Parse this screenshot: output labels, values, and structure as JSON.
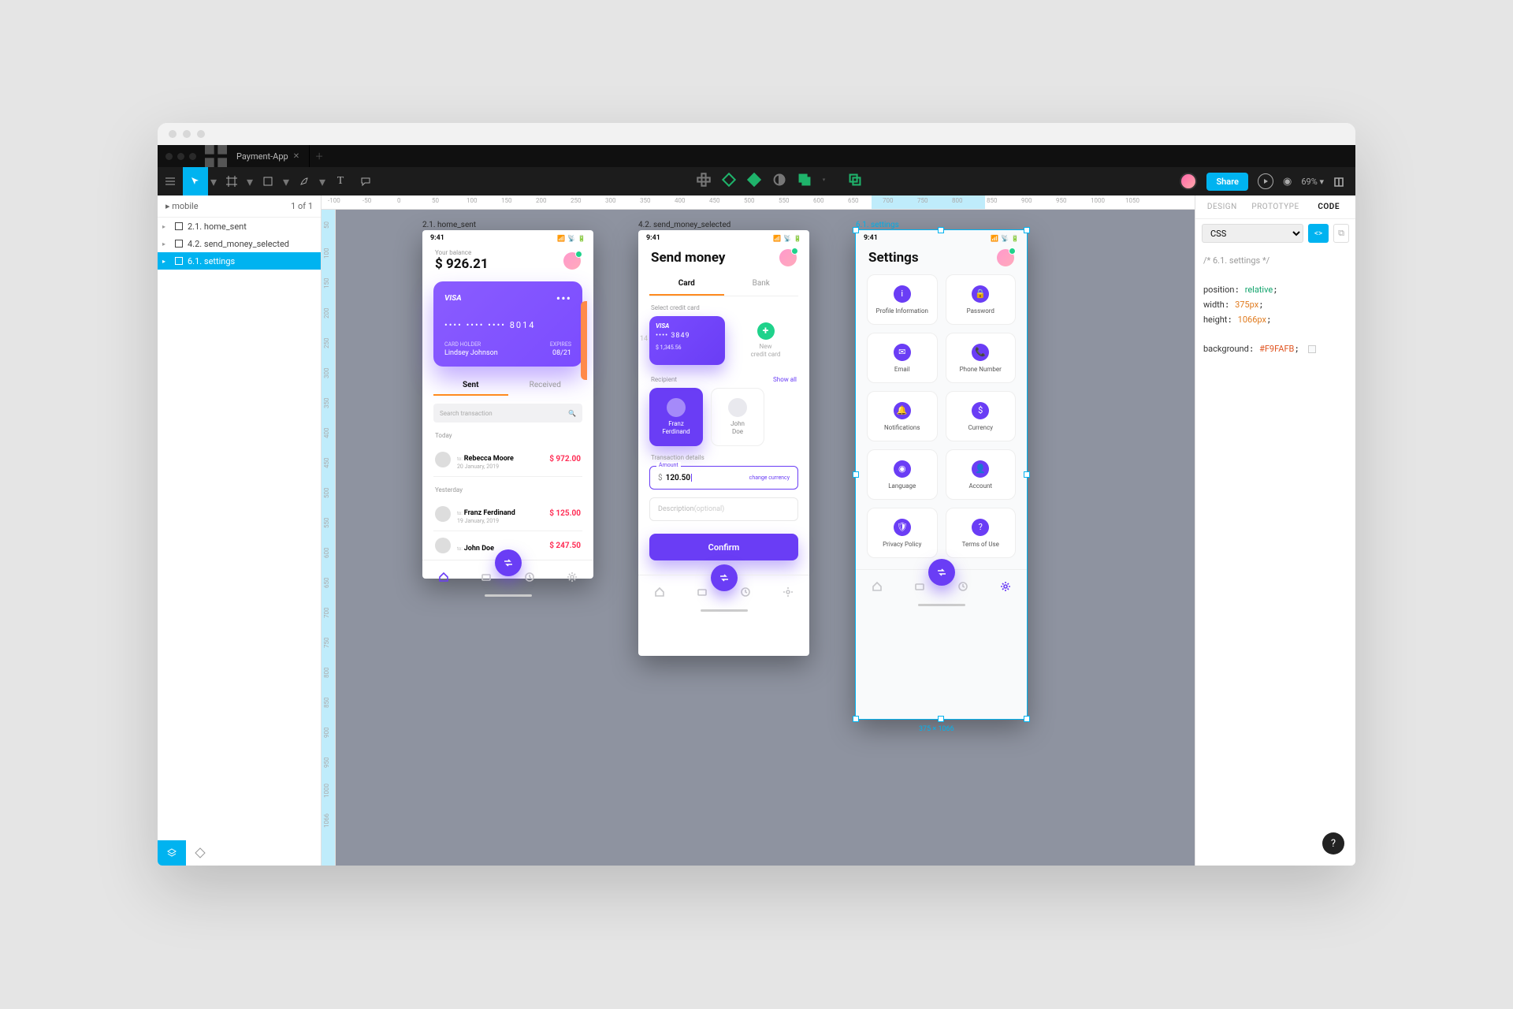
{
  "tab": {
    "name": "Payment-App"
  },
  "toolbar": {
    "share": "Share",
    "zoom": "69%"
  },
  "leftPanel": {
    "page": "mobile",
    "pageCount": "1 of 1",
    "items": [
      {
        "label": "2.1. home_sent"
      },
      {
        "label": "4.2. send_money_selected"
      },
      {
        "label": "6.1. settings"
      }
    ]
  },
  "rulerH": [
    "-100",
    "-50",
    "0",
    "50",
    "100",
    "150",
    "200",
    "250",
    "300",
    "350",
    "400",
    "450",
    "500",
    "550",
    "600",
    "650",
    "700",
    "750",
    "800",
    "850",
    "900",
    "950",
    "1000",
    "1050"
  ],
  "rulerV": [
    "50",
    "100",
    "150",
    "200",
    "250",
    "300",
    "350",
    "400",
    "450",
    "500",
    "550",
    "600",
    "650",
    "700",
    "750",
    "800",
    "850",
    "900",
    "950",
    "1000",
    "1066"
  ],
  "rulerSel": {
    "hStart": "800",
    "hEnd": "975",
    "vEnd": "1066"
  },
  "rightPanel": {
    "tabs": [
      "DESIGN",
      "PROTOTYPE",
      "CODE"
    ],
    "lang": "CSS",
    "code": {
      "comment": "/* 6.1. settings */",
      "lines": [
        {
          "k": "position",
          "v": "relative",
          "cls": "va"
        },
        {
          "k": "width",
          "v": "375px",
          "cls": "nu"
        },
        {
          "k": "height",
          "v": "1066px",
          "cls": "nu"
        }
      ],
      "bgKey": "background",
      "bgVal": "#F9FAFB"
    }
  },
  "artboards": {
    "a1": {
      "label": "2.1. home_sent",
      "time": "9:41",
      "balanceLabel": "Your balance",
      "balance": "$ 926.21",
      "card": {
        "brand": "VISA",
        "mask": "••••  ••••  ••••  8014",
        "holderL": "CARD HOLDER",
        "holder": "Lindsey Johnson",
        "expL": "EXPIRES",
        "exp": "08/21"
      },
      "tabs": [
        "Sent",
        "Received"
      ],
      "searchPh": "Search transaction",
      "groups": [
        {
          "label": "Today",
          "rows": [
            {
              "to": "to:",
              "name": "Rebecca Moore",
              "date": "20 January, 2019",
              "amount": "$ 972.00",
              "dir": "neg"
            }
          ]
        },
        {
          "label": "Yesterday",
          "rows": [
            {
              "to": "to:",
              "name": "Franz Ferdinand",
              "date": "19 January, 2019",
              "amount": "$ 125.00",
              "dir": "neg"
            },
            {
              "to": "to:",
              "name": "John Doe",
              "date": "",
              "amount": "$ 247.50",
              "dir": "neg"
            }
          ]
        }
      ]
    },
    "a2": {
      "label": "4.2. send_money_selected",
      "time": "9:41",
      "title": "Send money",
      "tabs": [
        "Card",
        "Bank"
      ],
      "selectLabel": "Select credit card",
      "miniCard": {
        "brand": "VISA",
        "num": "••••  3849",
        "bal": "$ 1,345.56"
      },
      "ghost": "14",
      "newCard": "New\ncredit card",
      "recipLabel": "Recipient",
      "showAll": "Show all",
      "recips": [
        {
          "name": "Franz\nFerdinand"
        },
        {
          "name": "John\nDoe"
        }
      ],
      "detailsLabel": "Transaction details",
      "amountLabel": "Amount",
      "amount": "120.50",
      "currency": "$",
      "change": "change currency",
      "descPh": "Description (optional)",
      "confirm": "Confirm"
    },
    "a3": {
      "label": "6.1. settings",
      "time": "9:41",
      "title": "Settings",
      "items": [
        "Profile Information",
        "Password",
        "Email",
        "Phone Number",
        "Notifications",
        "Currency",
        "Language",
        "Account",
        "Privacy Policy",
        "Terms of Use"
      ],
      "icons": [
        "i",
        "🔒",
        "✉",
        "📞",
        "🔔",
        "$",
        "◉",
        "👤",
        "🛡",
        "?"
      ]
    },
    "selDims": {
      "w": "375",
      "h": "1066",
      "label": "375 × 1066"
    }
  }
}
